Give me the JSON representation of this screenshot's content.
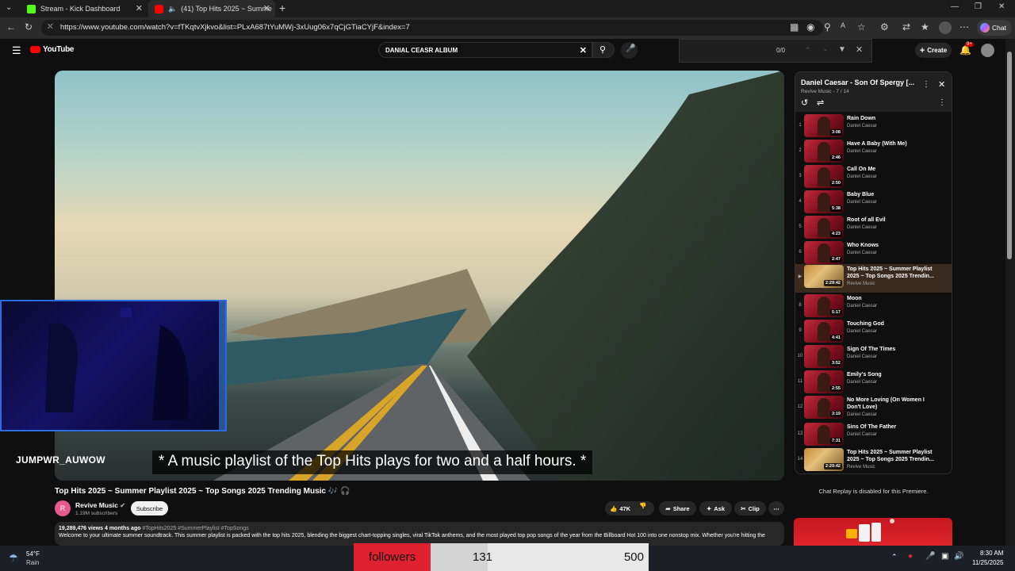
{
  "browser": {
    "tabs": [
      {
        "label": "Stream - Kick Dashboard",
        "icon": "kick-icon",
        "color": "#53fc18"
      },
      {
        "label": "(41) Top Hits 2025 ~ Summe",
        "icon": "youtube-icon",
        "color": "#ff0000",
        "active": true
      }
    ],
    "new_tab": "+",
    "url": "https://www.youtube.com/watch?v=fTKqtvXjkvo&list=PLxA687tYuMWj-3xUug06x7qCjGTiaCYjF&index=7",
    "chat_label": "Chat"
  },
  "youtube": {
    "logo_text": "YouTube",
    "search_value": "DANIAL CEASR ALBUM",
    "find": {
      "count": "0/0"
    },
    "create_label": "Create",
    "notif_badge": "9+"
  },
  "video": {
    "caption": "* A music playlist of the Top Hits plays for two and a half hours. *",
    "watermark": "JUMPWR_AUWOW",
    "title": "Top Hits 2025 ~ Summer Playlist 2025 ~ Top Songs 2025 Trending Music 🎶 🎧",
    "channel": "Revive Music",
    "channel_initial": "R",
    "subscribers": "1.19M subscribers",
    "subscribe_label": "Subscribe",
    "likes": "47K",
    "share_label": "Share",
    "ask_label": "Ask",
    "clip_label": "Clip",
    "views_meta": "19,289,476 views  4 months ago",
    "hashtags": "#TopHits2025 #SummerPlaylist #TopSongs",
    "description": "Welcome to your ultimate summer soundtrack. This summer playlist is packed with the top hits 2025, blending the biggest chart-topping singles, viral TikTok anthems, and the most played top pop songs of the year from the Billboard Hot 100 into one nonstop mix. Whether you're hitting the"
  },
  "playlist": {
    "title": "Daniel Caesar - Son Of Spergy [...",
    "subtitle": "Revive Music - 7 / 14",
    "items": [
      {
        "num": "1",
        "title": "Rain Down",
        "channel": "Daniel Caesar",
        "duration": "3:08"
      },
      {
        "num": "2",
        "title": "Have A Baby (With Me)",
        "channel": "Daniel Caesar",
        "duration": "2:46"
      },
      {
        "num": "3",
        "title": "Call On Me",
        "channel": "Daniel Caesar",
        "duration": "2:50"
      },
      {
        "num": "4",
        "title": "Baby Blue",
        "channel": "Daniel Caesar",
        "duration": "5:38"
      },
      {
        "num": "5",
        "title": "Root of all Evil",
        "channel": "Daniel Caesar",
        "duration": "4:23"
      },
      {
        "num": "6",
        "title": "Who Knows",
        "channel": "Daniel Caesar",
        "duration": "2:47"
      },
      {
        "num": "▶",
        "title": "Top Hits 2025 ~ Summer Playlist 2025 ~ Top Songs 2025 Trendin...",
        "channel": "Revive Music",
        "duration": "2:29:42",
        "current": true
      },
      {
        "num": "8",
        "title": "Moon",
        "channel": "Daniel Caesar",
        "duration": "5:17"
      },
      {
        "num": "9",
        "title": "Touching God",
        "channel": "Daniel Caesar",
        "duration": "4:41"
      },
      {
        "num": "10",
        "title": "Sign Of The Times",
        "channel": "Daniel Caesar",
        "duration": "3:52"
      },
      {
        "num": "11",
        "title": "Emily's Song",
        "channel": "Daniel Caesar",
        "duration": "2:55"
      },
      {
        "num": "12",
        "title": "No More Loving (On Women I Don't Love)",
        "channel": "Daniel Caesar",
        "duration": "3:19"
      },
      {
        "num": "13",
        "title": "Sins Of The Father",
        "channel": "Daniel Caesar",
        "duration": "7:31"
      },
      {
        "num": "14",
        "title": "Top Hits 2025 ~ Summer Playlist 2025 ~ Top Songs 2025 Trendin...",
        "channel": "Revive Music",
        "duration": "2:29:42"
      }
    ],
    "chat_replay": "Chat Replay is disabled for this Premiere."
  },
  "followers_widget": {
    "label": "followers",
    "current": "131",
    "goal": "500",
    "progress": 0.262
  },
  "taskbar": {
    "temp": "54°F",
    "weather": "Rain",
    "time": "8:30 AM",
    "date": "11/25/2025"
  }
}
